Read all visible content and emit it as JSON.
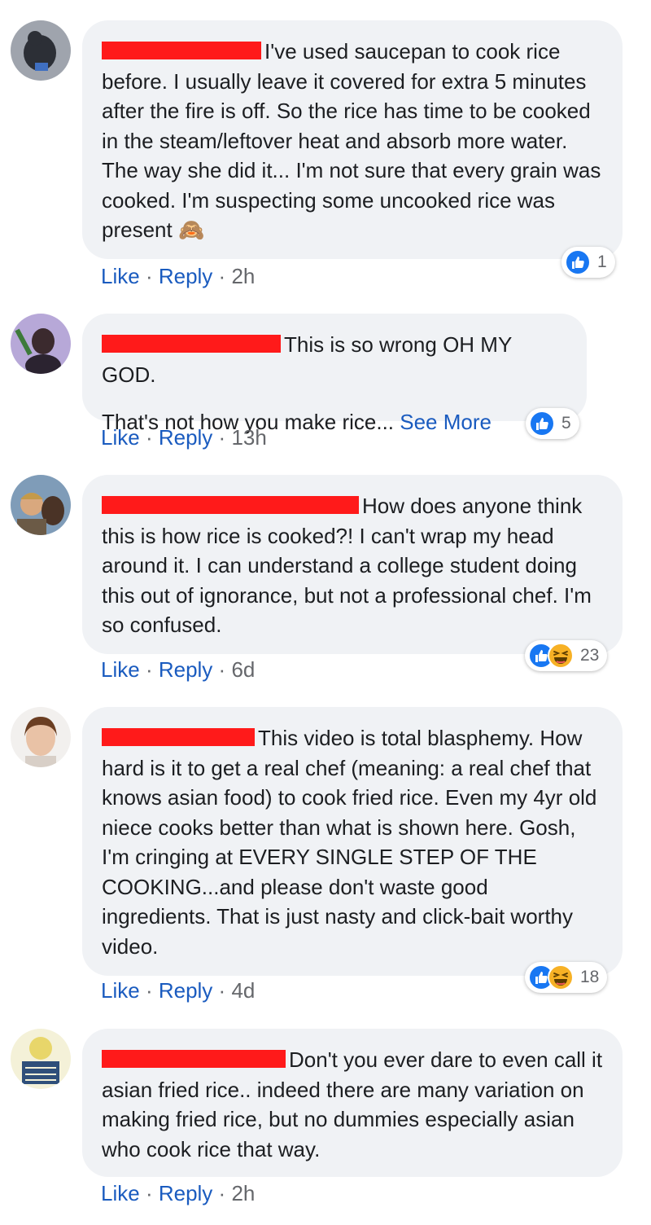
{
  "comments": [
    {
      "text": "I've used saucepan to cook rice before. I usually leave it covered for extra 5 minutes after the fire is off. So the rice has time to be cooked in the steam/leftover heat and absorb more water. The way she did it... I'm not sure that every grain was cooked. I'm suspecting some uncooked rice was present",
      "emoji": "🙈",
      "like": "Like",
      "reply": "Reply",
      "time": "2h",
      "reaction_count": "1"
    },
    {
      "text": "This is so wrong OH MY GOD.",
      "text2": "That's not how you make rice...",
      "see_more": "See More",
      "like": "Like",
      "reply": "Reply",
      "time": "13h",
      "reaction_count": "5"
    },
    {
      "text": "How does anyone think this is how rice is cooked?! I can't wrap my head around it. I can understand a college student doing this out of ignorance, but not a professional chef. I'm so confused.",
      "like": "Like",
      "reply": "Reply",
      "time": "6d",
      "reaction_count": "23"
    },
    {
      "text": "This video is total blasphemy. How hard is it to get a real chef (meaning: a real chef that knows asian food) to cook fried rice. Even my 4yr old niece cooks better than what is shown here. Gosh, I'm cringing at EVERY SINGLE STEP OF THE COOKING...and please don't waste good ingredients. That is just nasty and click-bait worthy video.",
      "like": "Like",
      "reply": "Reply",
      "time": "4d",
      "reaction_count": "18"
    },
    {
      "text": "Don't you ever dare to even call it asian fried rice.. indeed there are many variation on making fried rice, but no dummies especially asian who cook rice that way.",
      "like": "Like",
      "reply": "Reply",
      "time": "2h"
    }
  ],
  "colors": {
    "bubble": "#f0f2f5",
    "link": "#1a5bbf",
    "meta": "#65676b",
    "redaction": "#ff1a1a",
    "like_blue": "#1877f2",
    "haha_yellow": "#f7b125"
  },
  "icons": [
    "avatar-image",
    "like-reaction-icon",
    "haha-reaction-icon",
    "see-no-evil-monkey-emoji"
  ]
}
